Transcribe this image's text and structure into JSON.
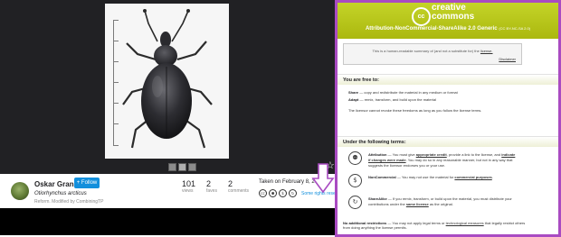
{
  "photo": {
    "caption_icons": [
      "image-thumb",
      "image-thumb",
      "image-thumb"
    ],
    "favorite_icon": "star-outline-icon"
  },
  "info": {
    "author": "Oskar Gran",
    "follow_label": "+ Follow",
    "species": "Otiorhynchus arcticus",
    "credit": "Reform. Modified by CombiningTP",
    "views": "101",
    "views_label": "views",
    "faves": "2",
    "faves_label": "faves",
    "comments": "2",
    "comments_label": "comments",
    "taken": "Taken on February 8, 2017",
    "rights": "Some rights reserved",
    "license_icons": [
      "cc",
      "by",
      "nc",
      "sa"
    ]
  },
  "license": {
    "brand_top": "creative",
    "brand_bottom": "commons",
    "logo_text": "cc",
    "title": "Attribution-NonCommercial-ShareAlike 2.0 Generic",
    "title_code": "(CC BY-NC-SA 2.0)",
    "summary": "This is a human-readable summary of (and not a substitute for) the",
    "summary_link": "license.",
    "disclaimer": "Disclaimer",
    "free_heading": "You are free to:",
    "share_term": "Share",
    "share_text": "— copy and redistribute the material in any medium or format",
    "adapt_term": "Adapt",
    "adapt_text": "— remix, transform, and build upon the material",
    "revoke_text": "The licensor cannot revoke these freedoms as long as you follow the license terms.",
    "terms_heading": "Under the following terms:",
    "attribution_term": "Attribution",
    "attribution_text_1": "— You must give",
    "attribution_link_1": "appropriate credit",
    "attribution_text_2": ", provide a link to the license, and",
    "attribution_link_2": "indicate",
    "attribution_link_3": "if changes were made",
    "attribution_text_3": ". You may do so in any reasonable manner, but not in any way that",
    "attribution_text_4": "suggests the licensor endorses you or your use.",
    "noncommercial_term": "NonCommercial",
    "noncommercial_text": "— You may not use the material for",
    "noncommercial_link": "commercial purposes",
    "sharealike_term": "ShareAlike",
    "sharealike_text_1": "— If you remix, transform, or build upon the material, you must distribute your",
    "sharealike_text_2": "contributions under the",
    "sharealike_link": "same license",
    "sharealike_text_3": "as the original.",
    "restrict_term": "No additional restrictions",
    "restrict_text_1": "— You may not apply legal terms or",
    "restrict_link": "technological measures",
    "restrict_text_2": "that legally restrict others",
    "restrict_text_3": "from doing anything the license permits.",
    "colors": {
      "header": "#b5c21a",
      "border": "#a94bc2"
    }
  }
}
